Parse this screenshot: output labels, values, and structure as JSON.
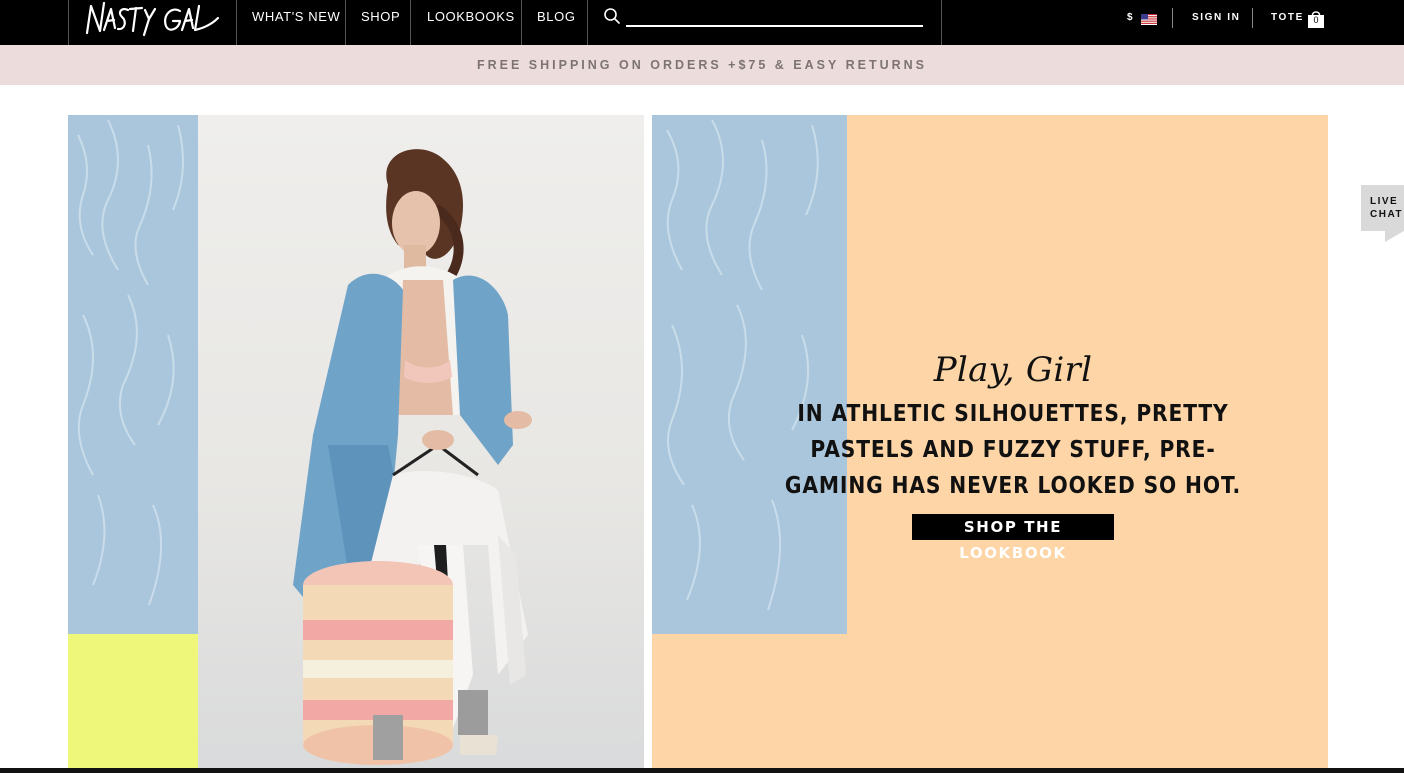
{
  "header": {
    "logo_text": "NASTY GAL",
    "nav": [
      "WHAT'S NEW",
      "SHOP",
      "LOOKBOOKS",
      "BLOG"
    ],
    "search": {
      "placeholder": "",
      "icon": "search-icon"
    },
    "currency": "$",
    "flag_icon": "us-flag-icon",
    "sign_in": "SIGN IN",
    "tote_label": "TOTE",
    "tote_count": "0",
    "tote_icon": "shopping-bag-icon"
  },
  "promo": {
    "text": "FREE SHIPPING ON ORDERS +$75 & EASY RETURNS",
    "background": "#ecdcdc"
  },
  "hero": {
    "script_title": "Play, Girl",
    "body": "IN ATHLETIC SILHOUETTES, PRETTY PASTELS AND FUZZY STUFF, PRE-GAMING HAS NEVER LOOKED SO HOT.",
    "cta": "SHOP THE LOOKBOOK",
    "colors": {
      "fur_blue": "#aac6dc",
      "peach": "#fdd5a6",
      "yellow": "#eef77a"
    }
  },
  "live_chat": {
    "line1": "LIVE",
    "line2": "CHAT"
  }
}
